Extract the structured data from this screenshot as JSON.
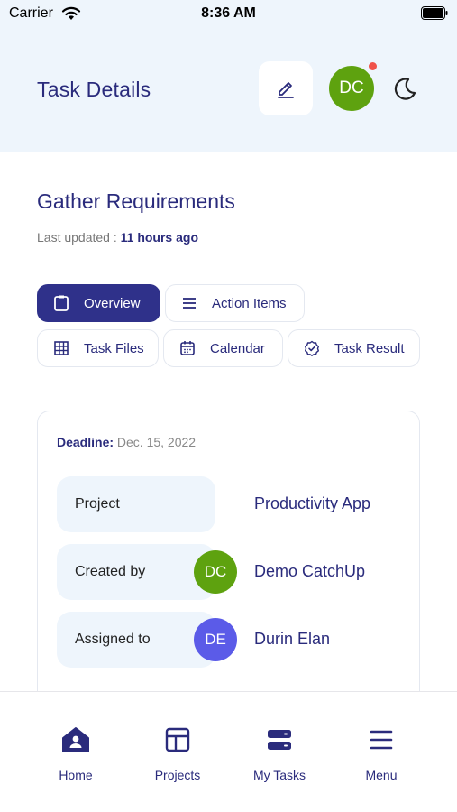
{
  "status_bar": {
    "carrier": "Carrier",
    "time": "8:36 AM"
  },
  "header": {
    "title": "Task Details",
    "avatar_initials": "DC",
    "avatar_color": "#5ea20f",
    "notification_dot_color": "#f0524a",
    "icons": [
      "edit-icon",
      "moon-icon"
    ]
  },
  "task": {
    "title": "Gather Requirements",
    "last_updated_label": "Last updated :",
    "last_updated_value": "11 hours ago"
  },
  "tabs": [
    {
      "label": "Overview",
      "icon": "clipboard-icon",
      "active": true
    },
    {
      "label": "Action Items",
      "icon": "list-icon",
      "active": false
    },
    {
      "label": "Task Files",
      "icon": "grid-icon",
      "active": false
    },
    {
      "label": "Calendar",
      "icon": "calendar-icon",
      "active": false
    },
    {
      "label": "Task Result",
      "icon": "check-badge-icon",
      "active": false
    }
  ],
  "details": {
    "deadline_label": "Deadline:",
    "deadline_value": "Dec. 15, 2022",
    "rows": [
      {
        "label": "Project",
        "value": "Productivity App"
      },
      {
        "label": "Created by",
        "value": "Demo CatchUp",
        "avatar_initials": "DC",
        "avatar_color": "#5ea20f"
      },
      {
        "label": "Assigned to",
        "value": "Durin Elan",
        "avatar_initials": "DE",
        "avatar_color": "#5b5be8"
      }
    ]
  },
  "bottom_nav": [
    {
      "label": "Home",
      "icon": "home-icon"
    },
    {
      "label": "Projects",
      "icon": "layout-icon"
    },
    {
      "label": "My Tasks",
      "icon": "tasks-icon"
    },
    {
      "label": "Menu",
      "icon": "menu-icon"
    }
  ],
  "colors": {
    "primary": "#2f318a",
    "text": "#2a2b7c",
    "header_bg": "#eef5fc"
  }
}
